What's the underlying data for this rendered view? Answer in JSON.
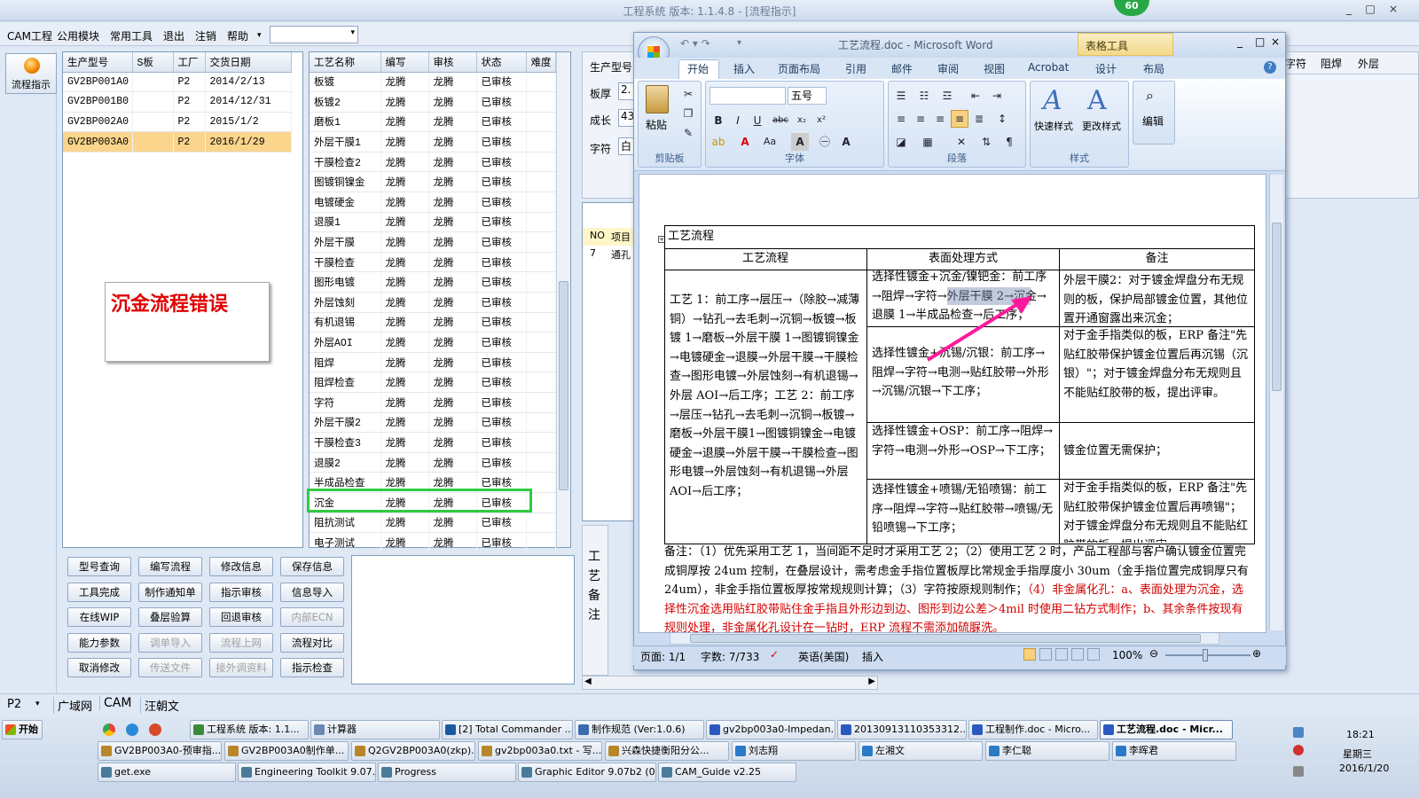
{
  "app": {
    "title": "工程系统  版本: 1.1.4.8 - [流程指示]",
    "badge": "60",
    "window_controls": [
      "_",
      "□",
      "×"
    ]
  },
  "menu": [
    "CAM工程",
    "公用模块",
    "常用工具",
    "退出",
    "注销",
    "帮助",
    "▾"
  ],
  "left_button": "流程指示",
  "product_table": {
    "headers": [
      "生产型号",
      "S板",
      "工厂",
      "交货日期"
    ],
    "rows": [
      [
        "GV2BP001A0",
        "",
        "P2",
        "2014/2/13"
      ],
      [
        "GV2BP001B0",
        "",
        "P2",
        "2014/12/31"
      ],
      [
        "GV2BP002A0",
        "",
        "P2",
        "2015/1/2"
      ],
      [
        "GV2BP003A0",
        "",
        "P2",
        "2016/1/29"
      ]
    ]
  },
  "error_note": "沉金流程错误",
  "process_table": {
    "headers": [
      "工艺名称",
      "编写",
      "审核",
      "状态",
      "难度"
    ],
    "rows": [
      [
        "板镀",
        "龙腾",
        "龙腾",
        "已审核",
        ""
      ],
      [
        "板镀2",
        "龙腾",
        "龙腾",
        "已审核",
        ""
      ],
      [
        "磨板1",
        "龙腾",
        "龙腾",
        "已审核",
        ""
      ],
      [
        "外层干膜1",
        "龙腾",
        "龙腾",
        "已审核",
        ""
      ],
      [
        "干膜检查2",
        "龙腾",
        "龙腾",
        "已审核",
        ""
      ],
      [
        "图镀铜镍金",
        "龙腾",
        "龙腾",
        "已审核",
        ""
      ],
      [
        "电镀硬金",
        "龙腾",
        "龙腾",
        "已审核",
        ""
      ],
      [
        "退膜1",
        "龙腾",
        "龙腾",
        "已审核",
        ""
      ],
      [
        "外层干膜",
        "龙腾",
        "龙腾",
        "已审核",
        ""
      ],
      [
        "干膜检查",
        "龙腾",
        "龙腾",
        "已审核",
        ""
      ],
      [
        "图形电镀",
        "龙腾",
        "龙腾",
        "已审核",
        ""
      ],
      [
        "外层蚀刻",
        "龙腾",
        "龙腾",
        "已审核",
        ""
      ],
      [
        "有机退锡",
        "龙腾",
        "龙腾",
        "已审核",
        ""
      ],
      [
        "外层AOI",
        "龙腾",
        "龙腾",
        "已审核",
        ""
      ],
      [
        "阻焊",
        "龙腾",
        "龙腾",
        "已审核",
        ""
      ],
      [
        "阻焊检查",
        "龙腾",
        "龙腾",
        "已审核",
        ""
      ],
      [
        "字符",
        "龙腾",
        "龙腾",
        "已审核",
        ""
      ],
      [
        "外层干膜2",
        "龙腾",
        "龙腾",
        "已审核",
        ""
      ],
      [
        "干膜检查3",
        "龙腾",
        "龙腾",
        "已审核",
        ""
      ],
      [
        "退膜2",
        "龙腾",
        "龙腾",
        "已审核",
        ""
      ],
      [
        "半成品检查",
        "龙腾",
        "龙腾",
        "已审核",
        ""
      ],
      [
        "沉金",
        "龙腾",
        "龙腾",
        "已审核",
        ""
      ],
      [
        "阻抗测试",
        "龙腾",
        "龙腾",
        "已审核",
        ""
      ],
      [
        "电子测试",
        "龙腾",
        "龙腾",
        "已审核",
        ""
      ]
    ]
  },
  "buttons": [
    [
      "型号查询",
      false
    ],
    [
      "编写流程",
      false
    ],
    [
      "修改信息",
      false
    ],
    [
      "保存信息",
      false
    ],
    [
      "工具完成",
      false
    ],
    [
      "制作通知单",
      false
    ],
    [
      "指示审核",
      false
    ],
    [
      "信息导入",
      false
    ],
    [
      "在线WIP",
      false
    ],
    [
      "叠层验算",
      false
    ],
    [
      "回退审核",
      false
    ],
    [
      "内部ECN",
      true
    ],
    [
      "能力参数",
      false
    ],
    [
      "调单导入",
      true
    ],
    [
      "流程上网",
      true
    ],
    [
      "流程对比",
      false
    ],
    [
      "取消修改",
      false
    ],
    [
      "传送文件",
      true
    ],
    [
      "接外调资料",
      true
    ],
    [
      "指示检查",
      false
    ]
  ],
  "right_panel": {
    "labels": [
      "生产型号",
      "板厚",
      "成长",
      "字符"
    ],
    "values": [
      "",
      "2.",
      "43",
      "白"
    ],
    "cols": [
      "字符",
      "阻焊",
      "外层"
    ],
    "mini_headers": [
      "NO",
      "项目"
    ],
    "mini_row": [
      "7",
      "通孔"
    ],
    "vert_label": "工艺备注"
  },
  "status": {
    "combo": "P2",
    "tabs": [
      "广域网",
      "CAM",
      "汪朝文"
    ]
  },
  "taskbar": {
    "start": "开始",
    "clock": "18:21",
    "weekday": "星期三",
    "date": "2016/1/20",
    "row1": [
      "工程系统  版本: 1.1...",
      "计算器",
      "[2] Total Commander ...",
      "制作规范 (Ver:1.0.6)",
      "gv2bp003a0-Impedan...",
      "20130913110353312...",
      "工程制作.doc - Micro...",
      "工艺流程.doc - Micr..."
    ],
    "row2": [
      "GV2BP003A0-预审指...",
      "GV2BP003A0制作单...",
      "Q2GV2BP003A0(zkp)...",
      "gv2bp003a0.txt - 写...",
      "兴森快捷衡阳分公...",
      "刘志翔",
      "左湘文",
      "李仁聪",
      "李晖君"
    ],
    "row3": [
      "get.exe",
      "Engineering Toolkit 9.07...",
      "Progress",
      "Graphic Editor 9.07b2 (0...",
      "CAM_Guide v2.25"
    ]
  },
  "word": {
    "title": "工艺流程.doc - Microsoft Word",
    "context_tab": "表格工具",
    "tabs": [
      "开始",
      "插入",
      "页面布局",
      "引用",
      "邮件",
      "审阅",
      "视图",
      "Acrobat",
      "设计",
      "布局"
    ],
    "groups": [
      "剪贴板",
      "字体",
      "段落",
      "样式",
      "编辑"
    ],
    "font_size": "五号",
    "paste": "粘贴",
    "quick_style": "快速样式",
    "change_style": "更改样式",
    "status": {
      "page": "页面: 1/1",
      "words": "字数: 7/733",
      "lang": "英语(美国)",
      "mode": "插入",
      "zoom": "100%"
    },
    "doc": {
      "title_row": "工艺流程",
      "headers": [
        "工艺流程",
        "表面处理方式",
        "备注"
      ],
      "col1": "工艺 1：前工序→层压→（除胶→减薄铜）→钻孔→去毛刺→沉铜→板镀→板镀 1→磨板→外层干膜 1→图镀铜镍金→电镀硬金→退膜→外层干膜→干膜检查→图形电镀→外层蚀刻→有机退锡→外层 AOI→后工序；工艺 2：前工序→层压→钻孔→去毛刺→沉铜→板镀→磨板→外层干膜1→图镀铜镍金→电镀硬金→退膜→外层干膜→干膜检查→图形电镀→外层蚀刻→有机退锡→外层 AOI→后工序；",
      "col2": [
        "选择性镀金+沉金/镍钯金：前工序→阻焊→字符→外层干膜 2→沉金→退膜 1→半成品检查→后工序；",
        "选择性镀金+沉锡/沉银：前工序→阻焊→字符→电测→贴红胶带→外形→沉锡/沉银→下工序；",
        "选择性镀金+OSP：前工序→阻焊→字符→电测→外形→OSP→下工序；",
        "选择性镀金+喷锡/无铅喷锡：前工序→阻焊→字符→贴红胶带→喷锡/无铅喷锡→下工序；"
      ],
      "col3": [
        "外层干膜2：对于镀金焊盘分布无规则的板，保护局部镀金位置，其他位置开通窗露出来沉金；",
        "对于金手指类似的板，ERP 备注\"先贴红胶带保护镀金位置后再沉锡（沉银）\"；对于镀金焊盘分布无规则且不能贴红胶带的板，提出评审。",
        "镀金位置无需保护；",
        "对于金手指类似的板，ERP 备注\"先贴红胶带保护镀金位置后再喷锡\"；对于镀金焊盘分布无规则且不能贴红胶带的板，提出评审。"
      ],
      "note_black": "备注：（1）优先采用工艺 1，当间距不足时才采用工艺 2；（2）使用工艺 2 时，产品工程部与客户确认镀金位置完成铜厚按 24um 控制，在叠层设计，需考虑金手指位置板厚比常规金手指厚度小 30um（金手指位置完成铜厚只有 24um），非金手指位置板厚按常规规则计算；（3）字符按原规则制作；",
      "note_red": "（4）非金属化孔：a、表面处理为沉金，选择性沉金选用贴红胶带贴住金手指且外形边到边、图形到边公差＞4mil 时使用二钻方式制作；b、其余条件按现有规则处理，非金属化孔设计在一钻时，ERP 流程不需添加硫脲洗。"
    }
  }
}
